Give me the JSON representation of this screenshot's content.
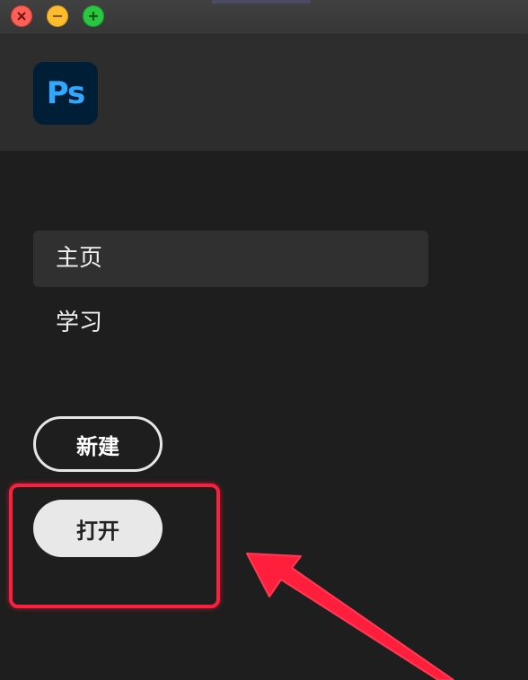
{
  "app": {
    "logo_text": "Ps",
    "brand_color": "#31a8ff"
  },
  "window_controls": {
    "close_icon": "close-icon",
    "minimize_icon": "minimize-icon",
    "maximize_icon": "maximize-icon"
  },
  "sidebar": {
    "items": [
      {
        "label": "主页",
        "selected": true
      },
      {
        "label": "学习",
        "selected": false
      }
    ]
  },
  "actions": {
    "new_label": "新建",
    "open_label": "打开"
  },
  "annotation": {
    "color": "#ff1f3d"
  }
}
